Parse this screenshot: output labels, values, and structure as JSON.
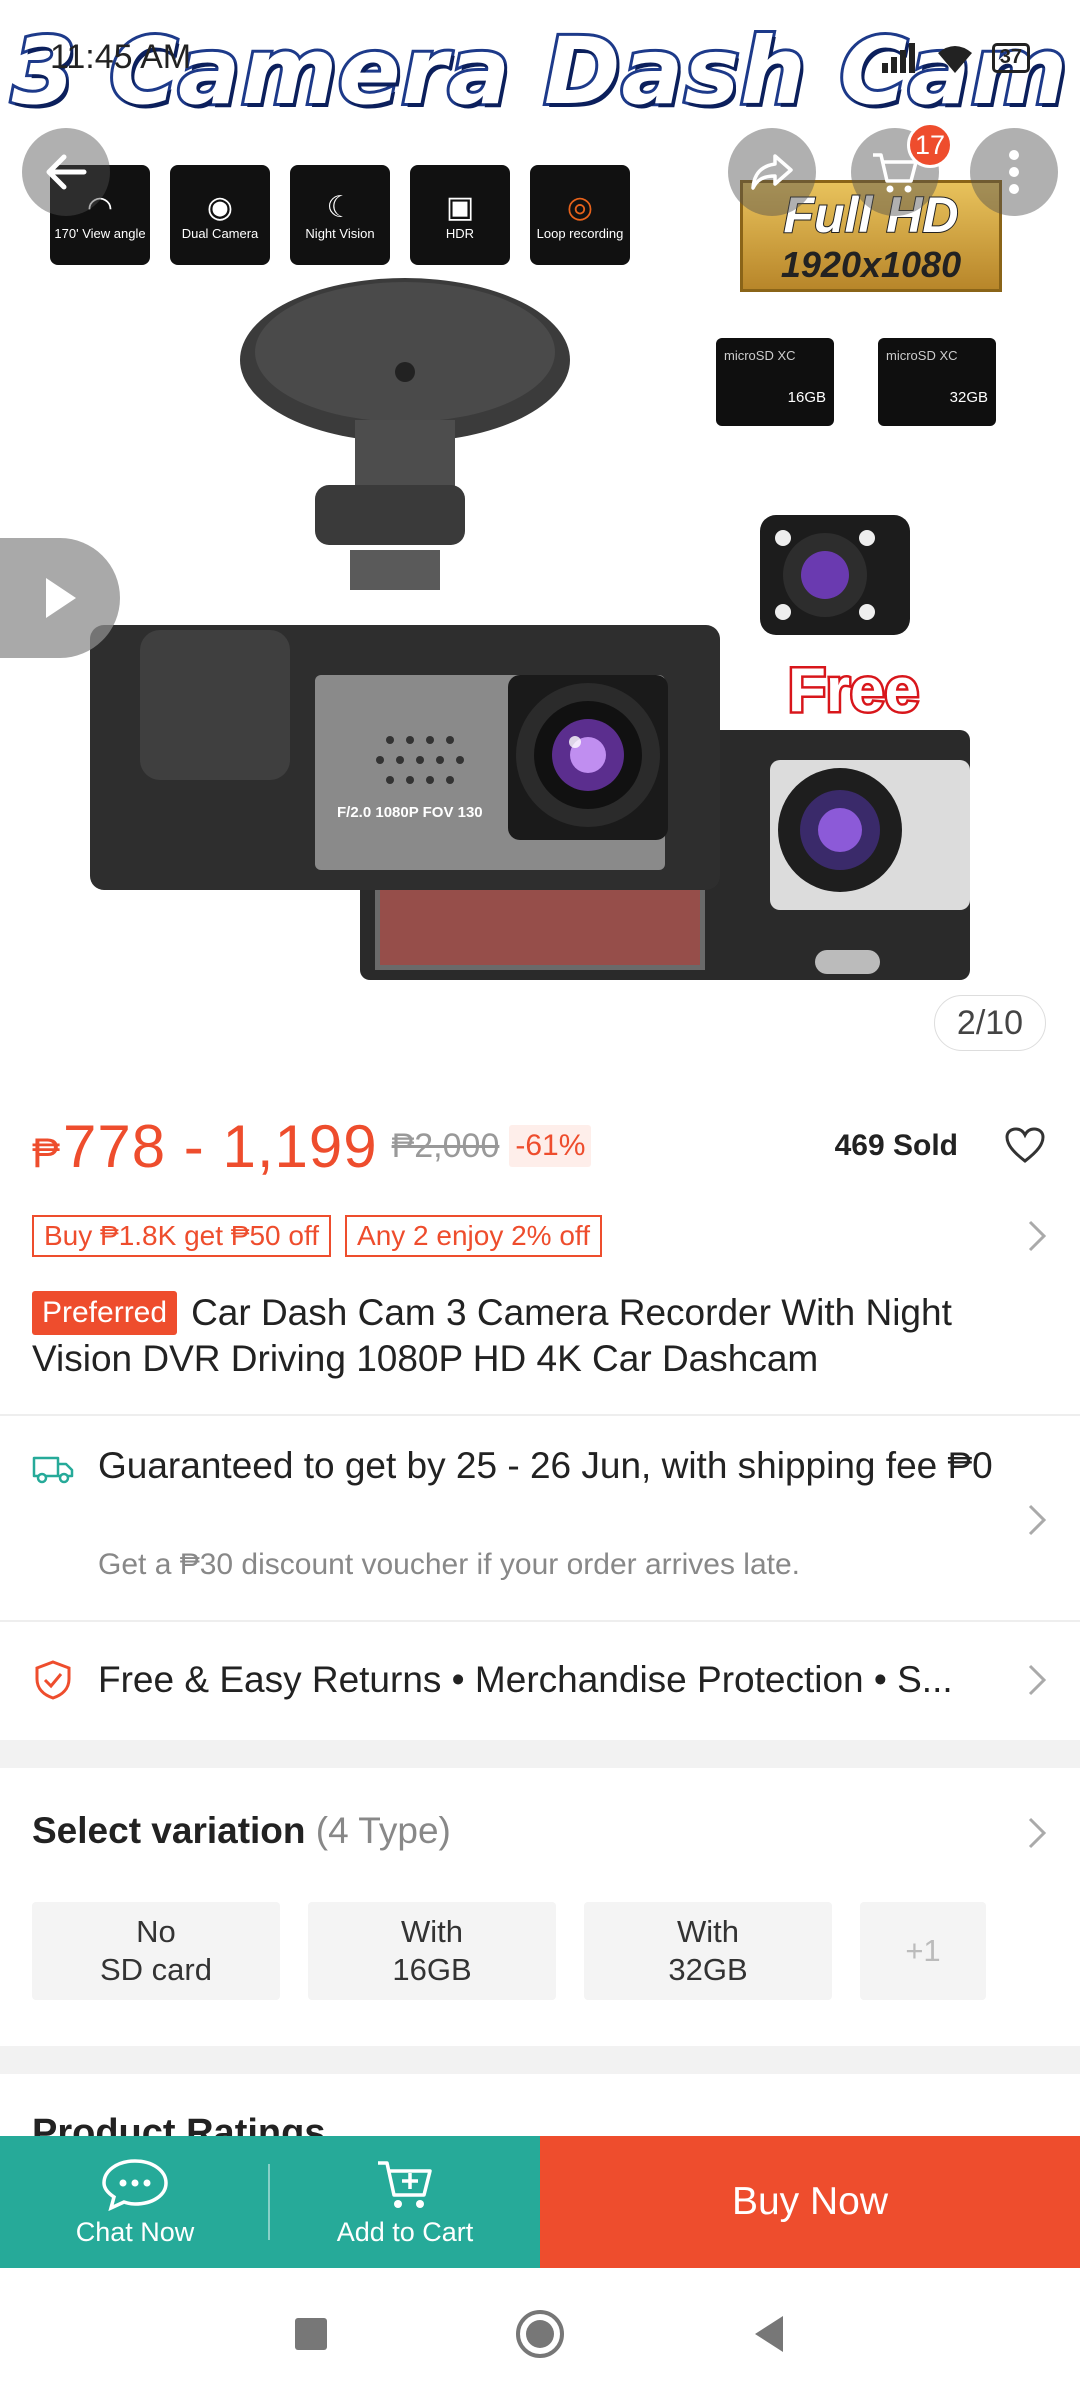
{
  "status_bar": {
    "time": "11:45 AM",
    "battery": "37"
  },
  "hero": {
    "headline": "3 Camera Dash Cam",
    "features": [
      {
        "label": "170' View angle",
        "icon": "angle-icon"
      },
      {
        "label": "Dual Camera",
        "icon": "webcam-icon"
      },
      {
        "label": "Night Vision",
        "icon": "eye-moon-icon"
      },
      {
        "label": "HDR",
        "icon": "hd-camera-icon"
      },
      {
        "label": "Loop recording",
        "icon": "record-icon"
      }
    ],
    "resolution_top": "Full HD",
    "resolution_bottom": "1920x1080",
    "sd_cards": [
      "16GB",
      "32GB"
    ],
    "lens_label": "F/2.0 1080P FOV 130",
    "free_label": "Free",
    "counter": "2/10"
  },
  "header": {
    "cart_count": "17"
  },
  "price": {
    "currency": "₱",
    "range": "778 - 1,199",
    "original": "₱2,000",
    "discount": "-61%",
    "sold": "469 Sold"
  },
  "promos": [
    "Buy ₱1.8K get ₱50 off",
    "Any 2 enjoy 2% off"
  ],
  "product": {
    "badge": "Preferred",
    "title": "Car Dash Cam 3 Camera Recorder With Night Vision DVR Driving 1080P HD 4K Car Dashcam"
  },
  "shipping": {
    "title": "Guaranteed to get by 25 - 26 Jun, with shipping fee ₱0",
    "subtitle": "Get a ₱30 discount voucher if your order arrives late."
  },
  "returns": {
    "text": "Free & Easy Returns  •  Merchandise Protection  •  S..."
  },
  "variation": {
    "heading": "Select variation",
    "count": "(4 Type)",
    "options": [
      "No\nSD card",
      "With\n16GB",
      "With\n32GB"
    ],
    "more": "+1"
  },
  "ratings": {
    "heading": "Product Ratings"
  },
  "actions": {
    "chat": "Chat Now",
    "cart": "Add to Cart",
    "buy": "Buy Now"
  },
  "colors": {
    "accent": "#ee4d2d",
    "teal": "#26aa99",
    "headline_stroke": "#1d3a8a"
  }
}
